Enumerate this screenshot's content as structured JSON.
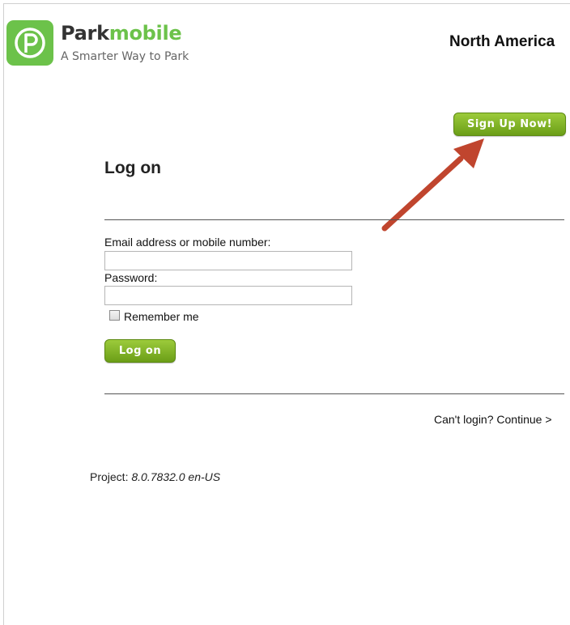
{
  "header": {
    "brand_part1": "Park",
    "brand_part2": "mobile",
    "tagline": "A Smarter Way to Park",
    "region": "North America",
    "logo_icon": "parkmobile-p-icon"
  },
  "signup": {
    "label": "Sign Up Now!"
  },
  "login_form": {
    "heading": "Log on",
    "email_label": "Email address or mobile number:",
    "email_value": "",
    "password_label": "Password:",
    "password_value": "",
    "remember_label": "Remember me",
    "remember_checked": false,
    "submit_label": "Log on"
  },
  "help": {
    "continue_text": "Can't login? Continue >"
  },
  "footer": {
    "project_label": "Project:",
    "project_version": "8.0.7832.0 en-US"
  },
  "colors": {
    "brand_green": "#6cc24a",
    "button_green": "#7fb32a",
    "arrow": "#c0452e"
  }
}
